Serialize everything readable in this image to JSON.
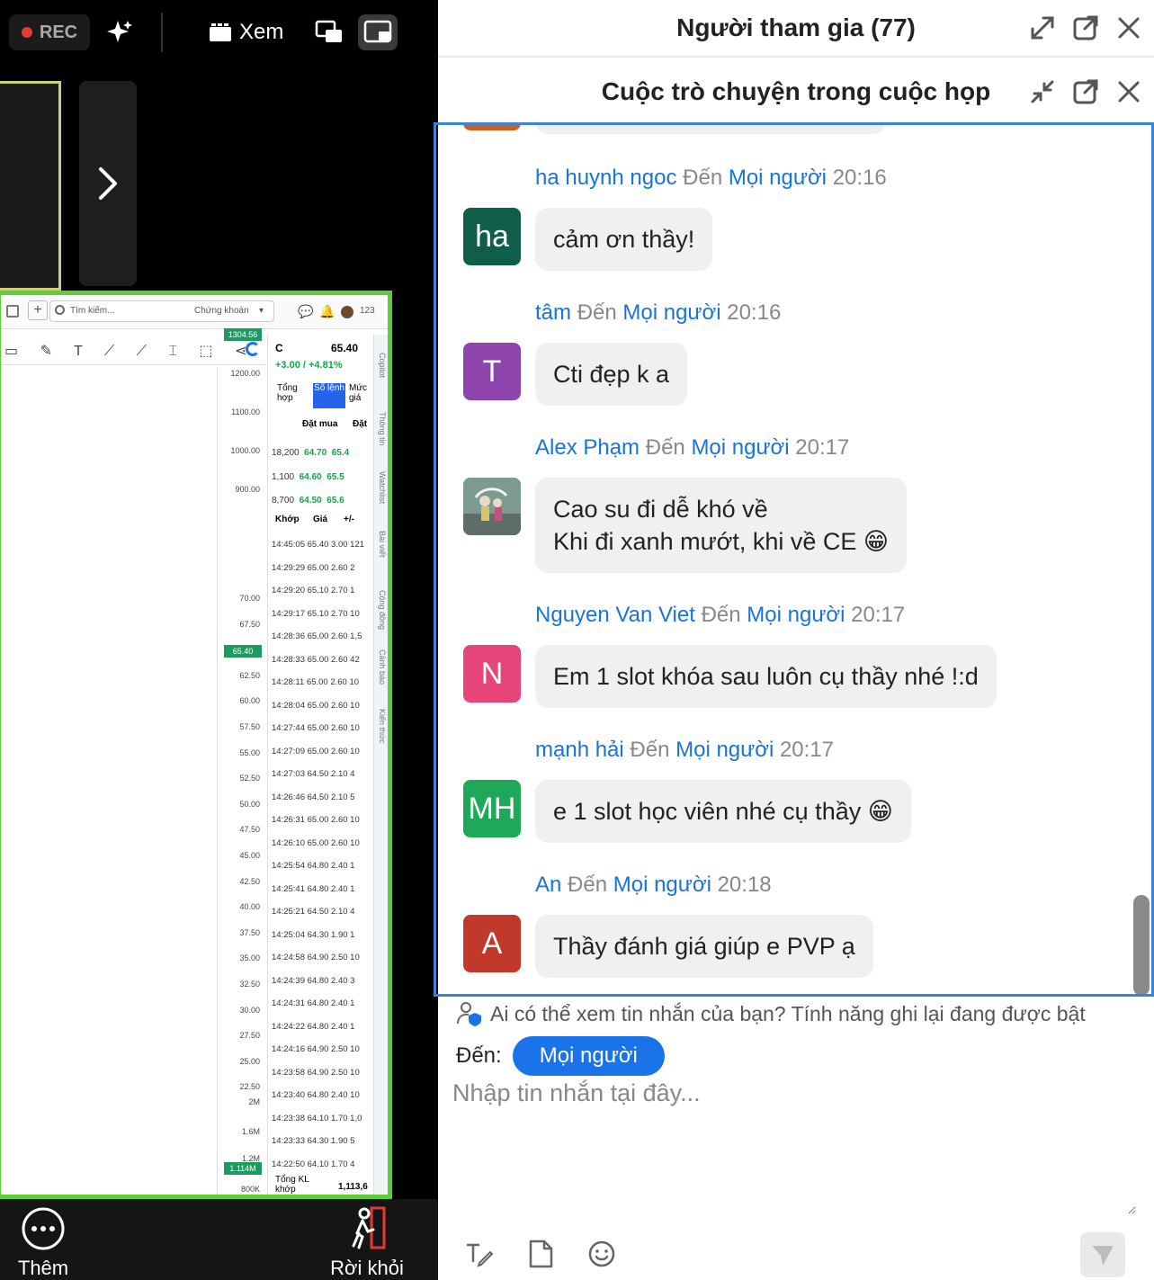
{
  "meeting": {
    "rec_label": "REC",
    "view_label": "Xem",
    "more_label": "Thêm",
    "leave_label": "Rời khỏi"
  },
  "shared_screen": {
    "search_placeholder": "Tìm kiếm...",
    "market_label": "Chứng khoán",
    "badge_count": "123",
    "symbol": "C",
    "price": "65.40",
    "change": "+3.00 / +4.81%",
    "tab_labels": [
      "Tổng hợp",
      "Sổ lệnh",
      "Mức giá"
    ],
    "bid_header": "Đặt mua",
    "ask_header": "Đặt",
    "bids": [
      {
        "qty": "18,200",
        "price": "64.70",
        "ask": "65.4"
      },
      {
        "qty": "1,100",
        "price": "64.60",
        "ask": "65.5"
      },
      {
        "qty": "8,700",
        "price": "64.50",
        "ask": "65.6"
      }
    ],
    "trade_headers": [
      "Khớp",
      "Giá",
      "+/-"
    ],
    "trades": [
      "14:45:05 65.40 3.00 121",
      "14:29:29 65.00 2.60 2",
      "14:29:20 65.10 2.70 1",
      "14:29:17 65.10 2.70 10",
      "14:28:36 65.00 2.60 1,5",
      "14:28:33 65.00 2.60 42",
      "14:28:11 65.00 2.60 10",
      "14:28:04 65.00 2.60 10",
      "14:27:44 65.00 2.60 10",
      "14:27:09 65.00 2.60 10",
      "14:27:03 64.50 2.10 4",
      "14:26:46 64.50 2.10 5",
      "14:26:31 65.00 2.60 10",
      "14:26:10 65.00 2.60 10",
      "14:25:54 64.80 2.40 1",
      "14:25:41 64.80 2.40 1",
      "14:25:21 64.50 2.10 4",
      "14:25:04 64.30 1.90 1",
      "14:24:58 64.90 2.50 10",
      "14:24:39 64.80 2.40 3",
      "14:24:31 64.80 2.40 1",
      "14:24:22 64.80 2.40 1",
      "14:24:16 64.90 2.50 10",
      "14:23:58 64.90 2.50 10",
      "14:23:40 64.80 2.40 10",
      "14:23:38 64.10 1.70 1,0",
      "14:23:33 64.30 1.90 5",
      "14:22:50 64.10 1.70 4"
    ],
    "total_label": "Tổng KL khớp",
    "total_value": "1,113,6",
    "axis_upper": [
      "1304.56",
      "1200.00",
      "1100.00",
      "1000.00",
      "900.00"
    ],
    "axis_lower": [
      "70.00",
      "67.50",
      "65.40",
      "62.50",
      "60.00",
      "57.50",
      "55.00",
      "52.50",
      "50.00",
      "47.50",
      "45.00",
      "42.50",
      "40.00",
      "37.50",
      "35.00",
      "32.50",
      "30.00",
      "27.50",
      "25.00",
      "22.50"
    ],
    "axis_volume": [
      "2M",
      "1.6M",
      "1.2M",
      "1.114M",
      "800K"
    ],
    "side_tabs": [
      "Copilot",
      "Thông tin",
      "Watchlist",
      "Bài viết",
      "Cộng đồng",
      "Cảnh báo",
      "Kiến thức"
    ],
    "tag_color": "#1e9a5e"
  },
  "chat": {
    "participants_title": "Người tham gia (77)",
    "chat_title": "Cuộc trò chuyện trong cuộc họp",
    "to_word": "Đến",
    "recipient": "Mọi người",
    "messages": [
      {
        "name": "ha huynh ngoc",
        "time": "20:16",
        "initials": "ha",
        "color": "#0f5e4a",
        "text": "cảm ơn thầy!"
      },
      {
        "name": "tâm",
        "time": "20:16",
        "initials": "T",
        "color": "#8e44ad",
        "text": "Cti đẹp k a"
      },
      {
        "name": "Alex Phạm",
        "time": "20:17",
        "initials": "",
        "color": "#6b8a8f",
        "text": "Cao su đi dễ khó về",
        "text2": "Khi đi xanh mướt, khi về CE 😁"
      },
      {
        "name": "Nguyen Van Viet",
        "time": "20:17",
        "initials": "N",
        "color": "#e6457a",
        "text": "Em 1 slot khóa sau luôn cụ thầy nhé !:d"
      },
      {
        "name": "mạnh hải",
        "time": "20:17",
        "initials": "MH",
        "color": "#1fa85a",
        "text": "e 1 slot học viên nhé cụ thầy 😁"
      },
      {
        "name": "An",
        "time": "20:18",
        "initials": "A",
        "color": "#c0392b",
        "text": "Thầy đánh giá giúp e PVP ạ"
      }
    ],
    "privacy_notice": "Ai có thể xem tin nhắn của bạn? Tính năng ghi lại đang được bật",
    "to_label": "Đến:",
    "input_placeholder": "Nhập tin nhắn tại đây...",
    "accent_color": "#1a73e8"
  }
}
